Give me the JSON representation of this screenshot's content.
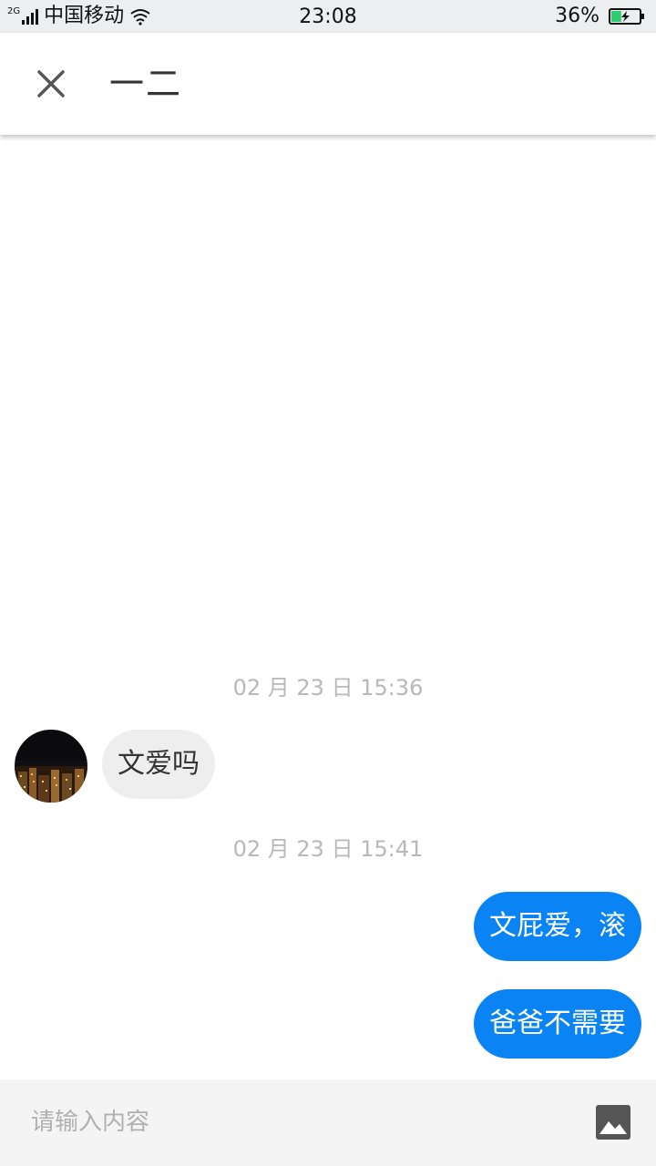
{
  "status_bar": {
    "network_type": "2G",
    "carrier": "中国移动",
    "time": "23:08",
    "battery_percent": "36%",
    "battery_level": 0.36,
    "icons": [
      "signal-icon",
      "wifi-icon",
      "battery-charging-icon"
    ]
  },
  "header": {
    "title": "一二",
    "close_icon": "close-icon"
  },
  "messages": [
    {
      "type": "timestamp",
      "text": "02 月 23 日 15:36"
    },
    {
      "type": "incoming",
      "text": "文爱吗",
      "avatar_icon": "city-night-avatar"
    },
    {
      "type": "timestamp",
      "text": "02 月 23 日 15:41"
    },
    {
      "type": "outgoing",
      "text": "文屁爱，滚"
    },
    {
      "type": "outgoing",
      "text": "爸爸不需要"
    }
  ],
  "input_bar": {
    "placeholder": "请输入内容",
    "value": "",
    "image_icon": "image-icon"
  },
  "colors": {
    "status_bar_bg": "#eceef0",
    "outgoing_bubble": "#0a84f4",
    "incoming_bubble": "#eeeeee",
    "timestamp_text": "#b8b8b8",
    "input_bar_bg": "#f4f4f4",
    "battery_fill": "#2ecc71"
  }
}
